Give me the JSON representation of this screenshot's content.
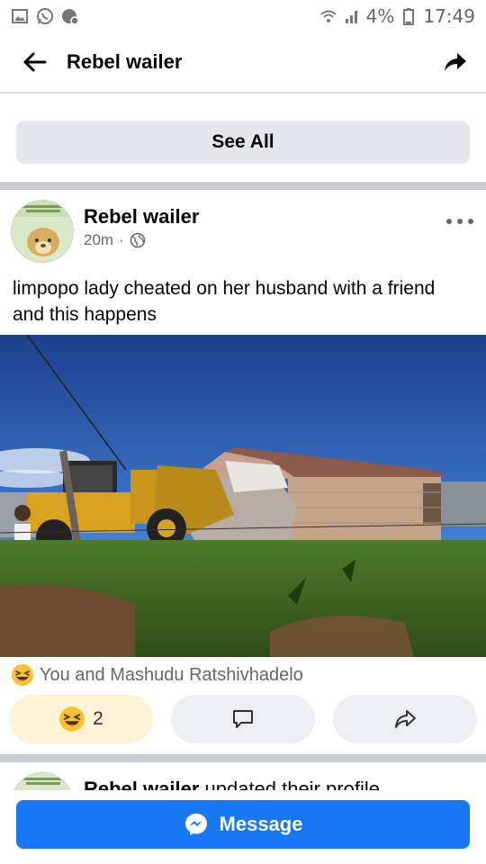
{
  "status_bar": {
    "battery": "4%",
    "time": "17:49",
    "icons": [
      "gallery-icon",
      "whatsapp-icon",
      "messenger-badge-icon",
      "wifi-icon",
      "signal-icon",
      "battery-icon"
    ]
  },
  "header": {
    "title": "Rebel wailer",
    "back_icon": "arrow-left-icon",
    "share_icon": "share-arrow-icon"
  },
  "see_all": {
    "label": "See All"
  },
  "post": {
    "author": "Rebel wailer",
    "time": "20m",
    "separator": "·",
    "privacy_icon": "globe-icon",
    "text": "limpopo lady cheated on her husband with a friend and this happens",
    "reactions_summary": "You and Mashudu Ratshivhadelo",
    "reaction_count": "2",
    "reaction_emoji": "laughing-emoji",
    "colors": {
      "react_bg": "#fdf3d6",
      "action_bg": "#eceef1"
    }
  },
  "next_post": {
    "author": "Rebel wailer",
    "action": " updated their profile"
  },
  "message_button": {
    "label": "Message",
    "color": "#1877f2"
  }
}
